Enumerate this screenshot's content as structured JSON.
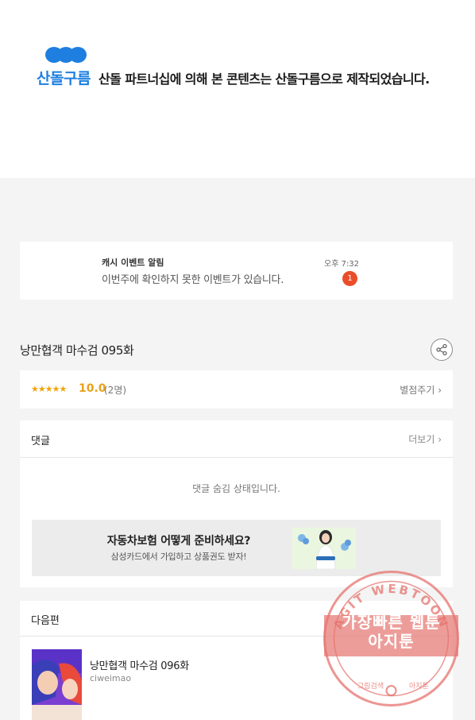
{
  "banner": {
    "logo_text": "산돌구름",
    "message": "산돌 파트너십에 의해 본 콘텐츠는 산돌구름으로 제작되었습니다.",
    "accent_color": "#1e7fe0"
  },
  "notification": {
    "title": "캐시 이벤트 알림",
    "message": "이번주에 확인하지 못한 이벤트가 있습니다.",
    "time": "오후 7:32",
    "badge_count": "1",
    "badge_color": "#e94e2a"
  },
  "episode": {
    "title": "낭만협객 마수검 095화",
    "share_icon": "share-icon"
  },
  "rating": {
    "stars": "★★★★★",
    "score": "10.0",
    "count": "(2명)",
    "rate_label": "별점주기 ›",
    "star_color": "#f0a30a"
  },
  "comments": {
    "title": "댓글",
    "more_label": "더보기 ›",
    "hidden_message": "댓글 숨김 상태입니다."
  },
  "ad": {
    "title": "자동차보험 어떻게 준비하세요?",
    "subtitle": "삼성카드에서 가입하고 상품권도 받자!"
  },
  "next_section": {
    "title": "다음편",
    "episode_title": "낭만협객 마수검 096화",
    "author": "ciweimao"
  },
  "watermark": {
    "ring_text": "AGIT WEBTOON",
    "main_line1": "가장빠른 웹툰",
    "main_line2": "아지툰",
    "bottom_left": "그림검색",
    "bottom_right": "아지툰",
    "color": "#e5736d"
  }
}
